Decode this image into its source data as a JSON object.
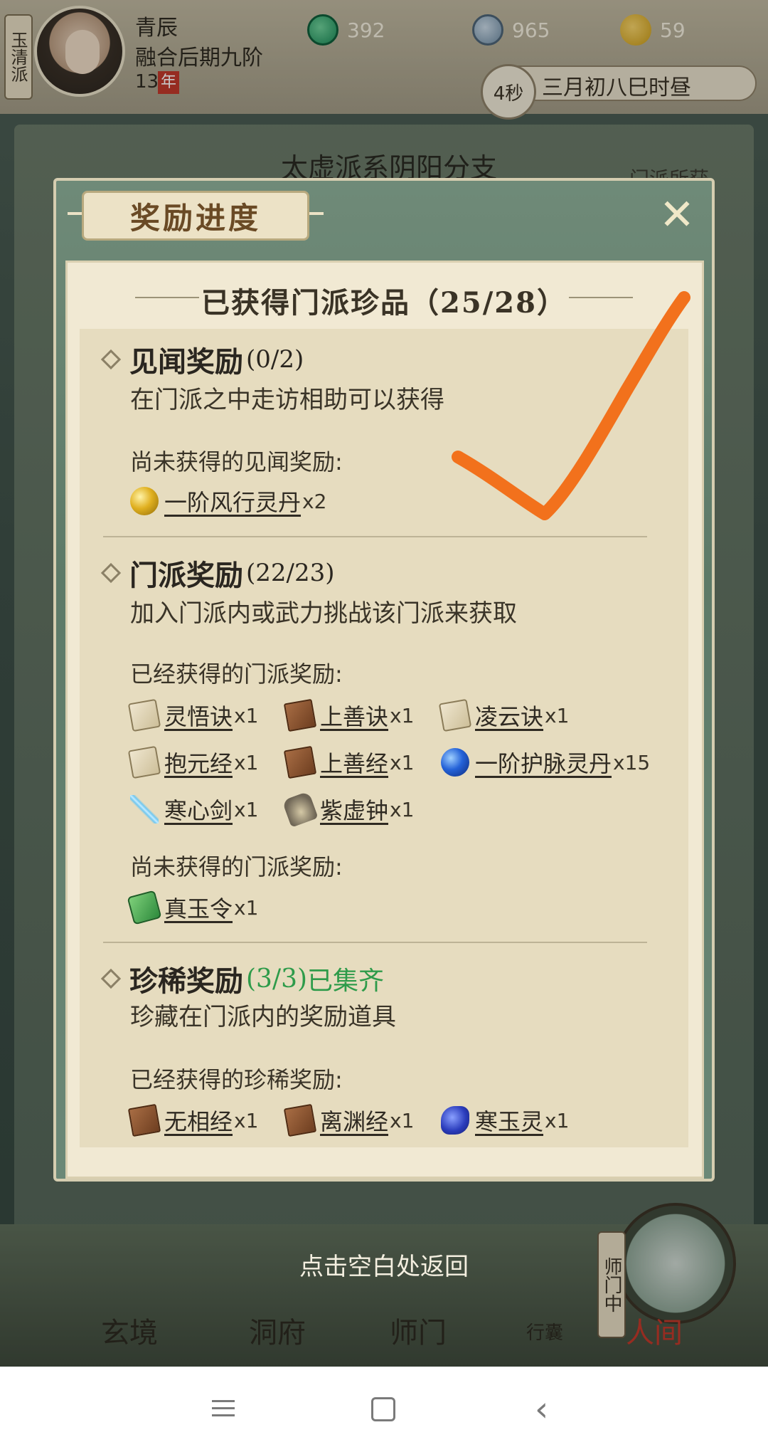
{
  "hud": {
    "faction": "玉清派",
    "player_name": "青辰",
    "player_realm": "融合后期九阶",
    "player_age": "13",
    "age_unit": "年",
    "currencies": [
      {
        "icon": "jade-currency-icon",
        "value": "392"
      },
      {
        "icon": "coin-currency-icon",
        "value": "965"
      },
      {
        "icon": "gold-currency-icon",
        "value": "59"
      }
    ],
    "timer": "4秒",
    "date": "三月初八巳时昼"
  },
  "scene": {
    "sect_title": "太虚派系阴阳分支",
    "sect_tag": "门派所获"
  },
  "modal": {
    "title": "奖励进度",
    "close_icon": "close-icon",
    "progress_heading": "已获得门派珍品（25/28）",
    "sections": [
      {
        "title": "见闻奖励",
        "count": "(0/2)",
        "description": "在门派之中走访相助可以获得",
        "groups": [
          {
            "label": "尚未获得的见闻奖励:",
            "items": [
              {
                "name": "一阶风行灵丹",
                "qty": "x2",
                "icon": "gold-pill-icon"
              }
            ]
          }
        ]
      },
      {
        "title": "门派奖励",
        "count": "(22/23)",
        "description": "加入门派内或武力挑战该门派来获取",
        "groups": [
          {
            "label": "已经获得的门派奖励:",
            "items": [
              {
                "name": "灵悟诀",
                "qty": "x1",
                "icon": "scroll-icon"
              },
              {
                "name": "上善诀",
                "qty": "x1",
                "icon": "book-icon"
              },
              {
                "name": "凌云诀",
                "qty": "x1",
                "icon": "scroll-icon"
              },
              {
                "name": "抱元经",
                "qty": "x1",
                "icon": "scroll-icon"
              },
              {
                "name": "上善经",
                "qty": "x1",
                "icon": "book-icon"
              },
              {
                "name": "一阶护脉灵丹",
                "qty": "x15",
                "icon": "blue-pill-icon"
              },
              {
                "name": "寒心剑",
                "qty": "x1",
                "icon": "sword-icon"
              },
              {
                "name": "紫虚钟",
                "qty": "x1",
                "icon": "bell-icon"
              }
            ]
          },
          {
            "label": "尚未获得的门派奖励:",
            "items": [
              {
                "name": "真玉令",
                "qty": "x1",
                "icon": "token-icon"
              }
            ]
          }
        ]
      },
      {
        "title": "珍稀奖励",
        "count": "(3/3)",
        "status": "已集齐",
        "description": "珍藏在门派内的奖励道具",
        "groups": [
          {
            "label": "已经获得的珍稀奖励:",
            "items": [
              {
                "name": "无相经",
                "qty": "x1",
                "icon": "book-icon"
              },
              {
                "name": "离渊经",
                "qty": "x1",
                "icon": "book-icon"
              },
              {
                "name": "寒玉灵",
                "qty": "x1",
                "icon": "spirit-icon"
              }
            ]
          }
        ]
      }
    ]
  },
  "back_hint": "点击空白处返回",
  "game_nav": {
    "items": [
      "玄境",
      "洞府",
      "师门",
      "行囊",
      "人间"
    ],
    "shimen_flag": "师门中"
  },
  "colors": {
    "complete": "#2e9b4a",
    "check_mark": "#f2711c"
  }
}
